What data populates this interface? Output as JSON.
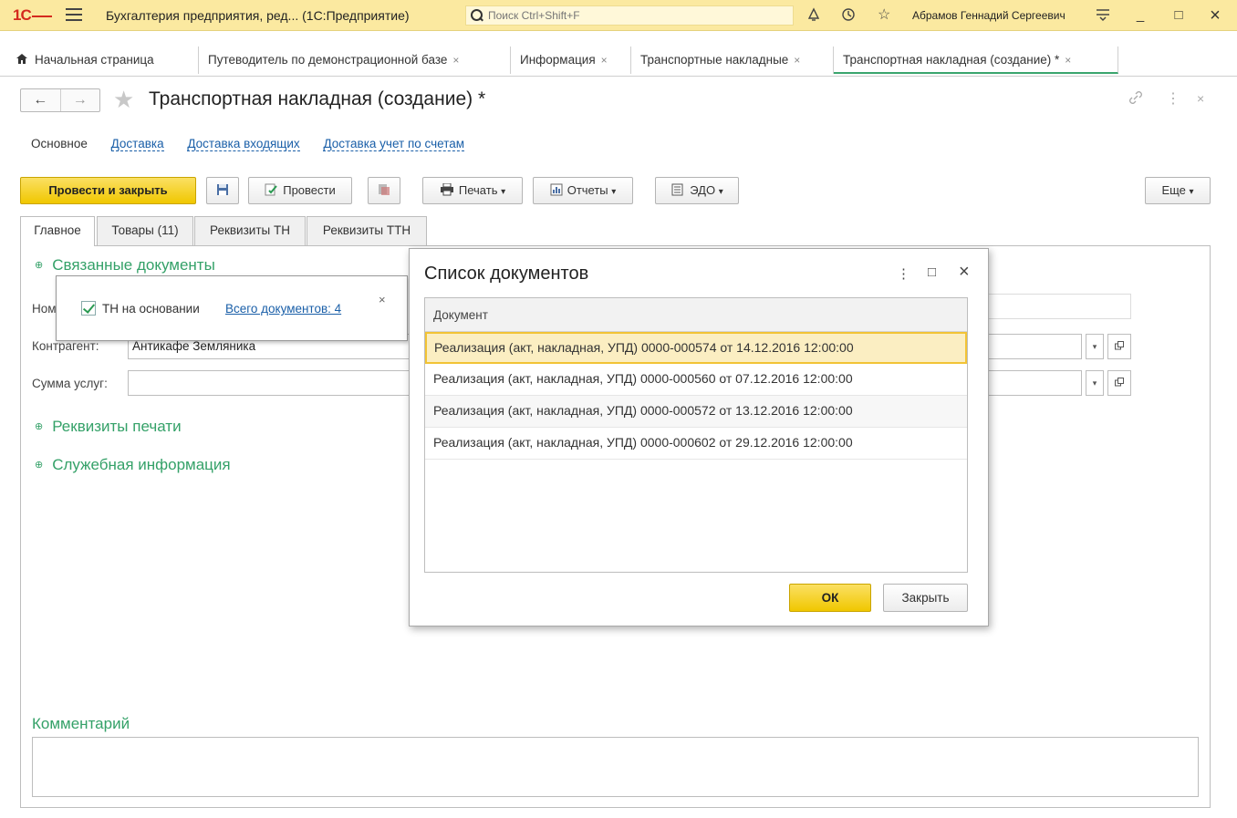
{
  "titlebar": {
    "logo": "1С",
    "app_title": "Бухгалтерия предприятия, ред...  (1С:Предприятие)",
    "search_placeholder": "Поиск Ctrl+Shift+F",
    "user": "Абрамов Геннадий Сергеевич",
    "bell": "♫",
    "history": "⟲",
    "star": "☆",
    "settings": "≡",
    "minimize": "_",
    "maximize": "□",
    "close": "×"
  },
  "open_tabs": [
    {
      "label": "Начальная страница"
    },
    {
      "label": "Путеводитель по демонстрационной базе"
    },
    {
      "label": "Информация"
    },
    {
      "label": "Транспортные накладные"
    },
    {
      "label": "Транспортная накладная (создание) *"
    }
  ],
  "tab_close": "×",
  "form": {
    "title": "Транспортная накладная (создание) *",
    "back": "←",
    "forward": "→",
    "link_icon": "🔗",
    "more_icon": "⋮",
    "close_icon": "×"
  },
  "section_nav": [
    "Основное",
    "Доставка",
    "Доставка входящих",
    "Доставка учет по счетам"
  ],
  "toolbar": {
    "post_close": "Провести и закрыть",
    "post": "Провести",
    "print": "Печать",
    "reports": "Отчеты",
    "edo": "ЭДО",
    "more": "Еще",
    "arrow": "▾"
  },
  "inner_tabs": [
    "Главное",
    "Товары (11)",
    "Реквизиты ТН",
    "Реквизиты ТТН"
  ],
  "main": {
    "group_linked": "Связанные документы",
    "label_number": "Ном",
    "label_counterparty": "Контрагент:",
    "counterparty_value": "Антикафе Земляника",
    "label_sum": "Сумма услуг:",
    "group_print": "Реквизиты печати",
    "group_service": "Служебная информация",
    "group_icon": "⊕",
    "comment_label": "Комментарий"
  },
  "popup": {
    "checkbox_label": "ТН на основании",
    "link": "Всего документов: 4",
    "close": "×"
  },
  "modal": {
    "title": "Список документов",
    "column": "Документ",
    "rows": [
      "Реализация (акт, накладная, УПД) 0000-000574 от 14.12.2016 12:00:00",
      "Реализация (акт, накладная, УПД) 0000-000560 от 07.12.2016 12:00:00",
      "Реализация (акт, накладная, УПД) 0000-000572 от 13.12.2016 12:00:00",
      "Реализация (акт, накладная, УПД) 0000-000602 от 29.12.2016 12:00:00"
    ],
    "ok": "ОК",
    "close_btn": "Закрыть",
    "more": "⋮",
    "maximize": "□",
    "close": "×"
  }
}
